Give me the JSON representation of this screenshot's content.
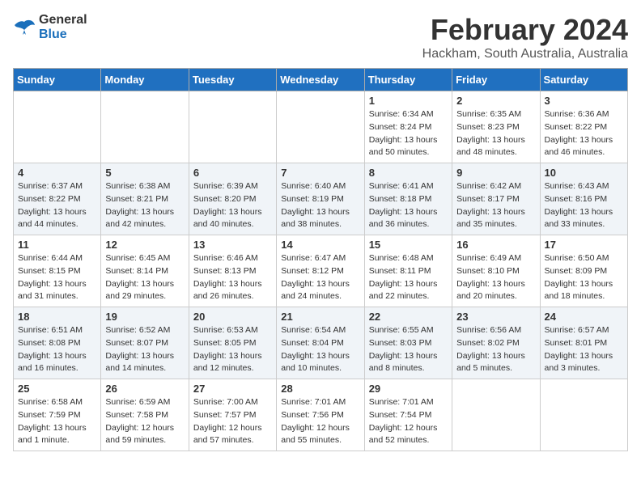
{
  "header": {
    "logo_general": "General",
    "logo_blue": "Blue",
    "title": "February 2024",
    "subtitle": "Hackham, South Australia, Australia"
  },
  "days_of_week": [
    "Sunday",
    "Monday",
    "Tuesday",
    "Wednesday",
    "Thursday",
    "Friday",
    "Saturday"
  ],
  "weeks": [
    {
      "days": [
        {
          "number": "",
          "sunrise": "",
          "sunset": "",
          "daylight": "",
          "empty": true
        },
        {
          "number": "",
          "sunrise": "",
          "sunset": "",
          "daylight": "",
          "empty": true
        },
        {
          "number": "",
          "sunrise": "",
          "sunset": "",
          "daylight": "",
          "empty": true
        },
        {
          "number": "",
          "sunrise": "",
          "sunset": "",
          "daylight": "",
          "empty": true
        },
        {
          "number": "1",
          "sunrise": "Sunrise: 6:34 AM",
          "sunset": "Sunset: 8:24 PM",
          "daylight": "Daylight: 13 hours and 50 minutes."
        },
        {
          "number": "2",
          "sunrise": "Sunrise: 6:35 AM",
          "sunset": "Sunset: 8:23 PM",
          "daylight": "Daylight: 13 hours and 48 minutes."
        },
        {
          "number": "3",
          "sunrise": "Sunrise: 6:36 AM",
          "sunset": "Sunset: 8:22 PM",
          "daylight": "Daylight: 13 hours and 46 minutes."
        }
      ]
    },
    {
      "days": [
        {
          "number": "4",
          "sunrise": "Sunrise: 6:37 AM",
          "sunset": "Sunset: 8:22 PM",
          "daylight": "Daylight: 13 hours and 44 minutes."
        },
        {
          "number": "5",
          "sunrise": "Sunrise: 6:38 AM",
          "sunset": "Sunset: 8:21 PM",
          "daylight": "Daylight: 13 hours and 42 minutes."
        },
        {
          "number": "6",
          "sunrise": "Sunrise: 6:39 AM",
          "sunset": "Sunset: 8:20 PM",
          "daylight": "Daylight: 13 hours and 40 minutes."
        },
        {
          "number": "7",
          "sunrise": "Sunrise: 6:40 AM",
          "sunset": "Sunset: 8:19 PM",
          "daylight": "Daylight: 13 hours and 38 minutes."
        },
        {
          "number": "8",
          "sunrise": "Sunrise: 6:41 AM",
          "sunset": "Sunset: 8:18 PM",
          "daylight": "Daylight: 13 hours and 36 minutes."
        },
        {
          "number": "9",
          "sunrise": "Sunrise: 6:42 AM",
          "sunset": "Sunset: 8:17 PM",
          "daylight": "Daylight: 13 hours and 35 minutes."
        },
        {
          "number": "10",
          "sunrise": "Sunrise: 6:43 AM",
          "sunset": "Sunset: 8:16 PM",
          "daylight": "Daylight: 13 hours and 33 minutes."
        }
      ]
    },
    {
      "days": [
        {
          "number": "11",
          "sunrise": "Sunrise: 6:44 AM",
          "sunset": "Sunset: 8:15 PM",
          "daylight": "Daylight: 13 hours and 31 minutes."
        },
        {
          "number": "12",
          "sunrise": "Sunrise: 6:45 AM",
          "sunset": "Sunset: 8:14 PM",
          "daylight": "Daylight: 13 hours and 29 minutes."
        },
        {
          "number": "13",
          "sunrise": "Sunrise: 6:46 AM",
          "sunset": "Sunset: 8:13 PM",
          "daylight": "Daylight: 13 hours and 26 minutes."
        },
        {
          "number": "14",
          "sunrise": "Sunrise: 6:47 AM",
          "sunset": "Sunset: 8:12 PM",
          "daylight": "Daylight: 13 hours and 24 minutes."
        },
        {
          "number": "15",
          "sunrise": "Sunrise: 6:48 AM",
          "sunset": "Sunset: 8:11 PM",
          "daylight": "Daylight: 13 hours and 22 minutes."
        },
        {
          "number": "16",
          "sunrise": "Sunrise: 6:49 AM",
          "sunset": "Sunset: 8:10 PM",
          "daylight": "Daylight: 13 hours and 20 minutes."
        },
        {
          "number": "17",
          "sunrise": "Sunrise: 6:50 AM",
          "sunset": "Sunset: 8:09 PM",
          "daylight": "Daylight: 13 hours and 18 minutes."
        }
      ]
    },
    {
      "days": [
        {
          "number": "18",
          "sunrise": "Sunrise: 6:51 AM",
          "sunset": "Sunset: 8:08 PM",
          "daylight": "Daylight: 13 hours and 16 minutes."
        },
        {
          "number": "19",
          "sunrise": "Sunrise: 6:52 AM",
          "sunset": "Sunset: 8:07 PM",
          "daylight": "Daylight: 13 hours and 14 minutes."
        },
        {
          "number": "20",
          "sunrise": "Sunrise: 6:53 AM",
          "sunset": "Sunset: 8:05 PM",
          "daylight": "Daylight: 13 hours and 12 minutes."
        },
        {
          "number": "21",
          "sunrise": "Sunrise: 6:54 AM",
          "sunset": "Sunset: 8:04 PM",
          "daylight": "Daylight: 13 hours and 10 minutes."
        },
        {
          "number": "22",
          "sunrise": "Sunrise: 6:55 AM",
          "sunset": "Sunset: 8:03 PM",
          "daylight": "Daylight: 13 hours and 8 minutes."
        },
        {
          "number": "23",
          "sunrise": "Sunrise: 6:56 AM",
          "sunset": "Sunset: 8:02 PM",
          "daylight": "Daylight: 13 hours and 5 minutes."
        },
        {
          "number": "24",
          "sunrise": "Sunrise: 6:57 AM",
          "sunset": "Sunset: 8:01 PM",
          "daylight": "Daylight: 13 hours and 3 minutes."
        }
      ]
    },
    {
      "days": [
        {
          "number": "25",
          "sunrise": "Sunrise: 6:58 AM",
          "sunset": "Sunset: 7:59 PM",
          "daylight": "Daylight: 13 hours and 1 minute."
        },
        {
          "number": "26",
          "sunrise": "Sunrise: 6:59 AM",
          "sunset": "Sunset: 7:58 PM",
          "daylight": "Daylight: 12 hours and 59 minutes."
        },
        {
          "number": "27",
          "sunrise": "Sunrise: 7:00 AM",
          "sunset": "Sunset: 7:57 PM",
          "daylight": "Daylight: 12 hours and 57 minutes."
        },
        {
          "number": "28",
          "sunrise": "Sunrise: 7:01 AM",
          "sunset": "Sunset: 7:56 PM",
          "daylight": "Daylight: 12 hours and 55 minutes."
        },
        {
          "number": "29",
          "sunrise": "Sunrise: 7:01 AM",
          "sunset": "Sunset: 7:54 PM",
          "daylight": "Daylight: 12 hours and 52 minutes."
        },
        {
          "number": "",
          "sunrise": "",
          "sunset": "",
          "daylight": "",
          "empty": true
        },
        {
          "number": "",
          "sunrise": "",
          "sunset": "",
          "daylight": "",
          "empty": true
        }
      ]
    }
  ]
}
